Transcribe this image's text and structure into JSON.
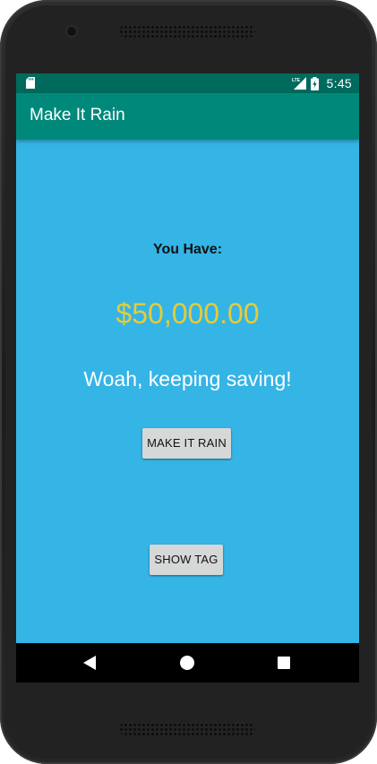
{
  "status_bar": {
    "time": "5:45",
    "network_label": "LTE",
    "icons": [
      "sd-card-icon",
      "lte-signal-icon",
      "battery-charging-icon"
    ]
  },
  "app_bar": {
    "title": "Make It Rain"
  },
  "main": {
    "label": "You Have:",
    "amount": "$50,000.00",
    "message": "Woah, keeping saving!",
    "make_it_rain_button": "MAKE IT RAIN",
    "show_tag_button": "SHOW TAG"
  },
  "nav_bar": {
    "icons": [
      "back-icon",
      "home-icon",
      "recents-icon"
    ]
  },
  "colors": {
    "background": "#35b4e6",
    "app_bar": "#00897a",
    "status_bar": "#006a5d",
    "amount_text": "#e6cc38",
    "button": "#d6d7d7"
  }
}
